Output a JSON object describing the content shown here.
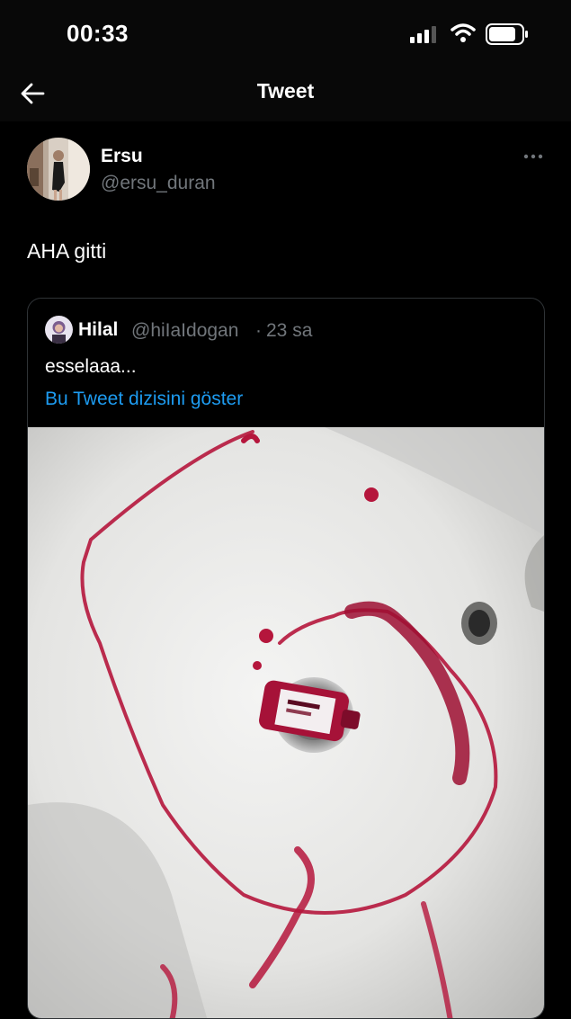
{
  "status_bar": {
    "time": "00:33"
  },
  "nav": {
    "title": "Tweet"
  },
  "tweet": {
    "display_name": "Ersu",
    "handle": "@ersu_duran",
    "text": "AHA gitti"
  },
  "quoted": {
    "display_name": "Hilal",
    "handle": "@hiIaIdogan",
    "separator": "·",
    "time": "23 sa",
    "text": "esselaaa...",
    "thread_link": "Bu Tweet dizisini göster"
  },
  "colors": {
    "background": "#000000",
    "accent": "#1d9bf0",
    "muted": "#71767b",
    "border": "#2f3336"
  },
  "icons": [
    "back-arrow-icon",
    "cellular-signal-icon",
    "wifi-icon",
    "battery-icon",
    "more-options-icon"
  ]
}
